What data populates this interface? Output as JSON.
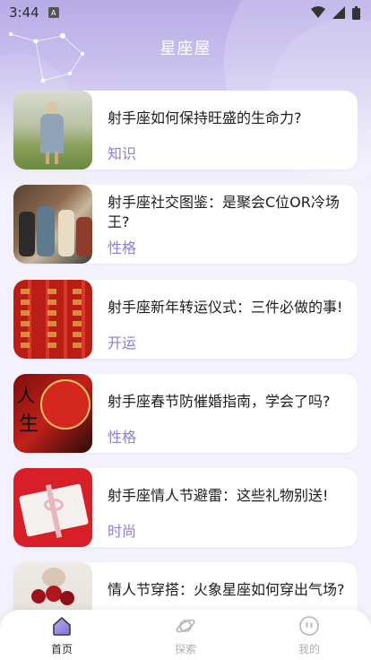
{
  "status_bar": {
    "time": "3:44",
    "notif": "A"
  },
  "header": {
    "title": "星座屋"
  },
  "articles": [
    {
      "title": "射手座如何保持旺盛的生命力?",
      "tag": "知识",
      "thumb": "woman-field-photo"
    },
    {
      "title": "射手座社交图鉴：是聚会C位OR冷场王?",
      "tag": "性格",
      "thumb": "party-photo"
    },
    {
      "title": "射手座新年转运仪式：三件必做的事!",
      "tag": "开运",
      "thumb": "red-couplets-photo"
    },
    {
      "title": "射手座春节防催婚指南，学会了吗?",
      "tag": "性格",
      "thumb": "red-lantern-photo"
    },
    {
      "title": "射手座情人节避雷：这些礼物别送!",
      "tag": "时尚",
      "thumb": "gift-box-photo"
    },
    {
      "title": "情人节穿搭：火象星座如何穿出气场?",
      "tag": "",
      "thumb": "roses-photo"
    }
  ],
  "tabs": [
    {
      "label": "首页",
      "icon": "home-icon",
      "active": true
    },
    {
      "label": "探索",
      "icon": "planet-icon",
      "active": false
    },
    {
      "label": "我的",
      "icon": "profile-icon",
      "active": false
    }
  ],
  "colors": {
    "accent": "#8a7fd6",
    "header_bg": "#b7abe6",
    "page_bg": "#f3f1fb"
  }
}
